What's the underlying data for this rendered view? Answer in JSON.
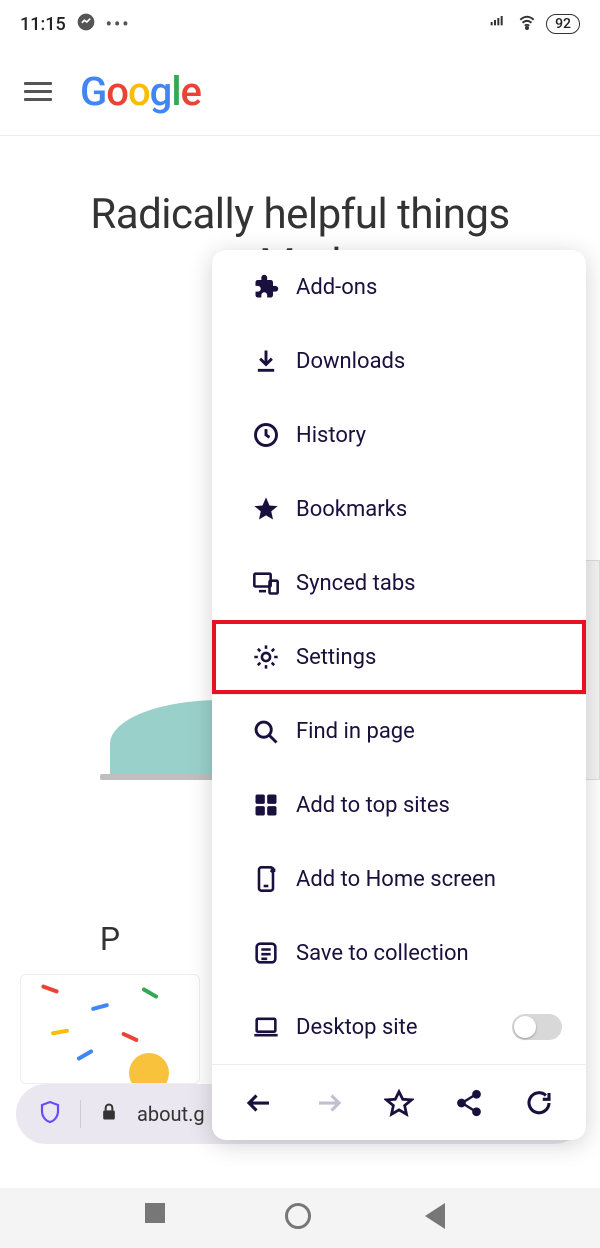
{
  "status": {
    "time": "11:15",
    "battery": "92"
  },
  "header": {
    "logo_text": "Google"
  },
  "hero": {
    "line1": "Radically helpful things",
    "line2_partial": "Mad"
  },
  "products_heading_partial": "P",
  "address_bar": {
    "url_display": "about.g"
  },
  "menu": {
    "items": [
      {
        "id": "addons",
        "label": "Add-ons"
      },
      {
        "id": "downloads",
        "label": "Downloads"
      },
      {
        "id": "history",
        "label": "History"
      },
      {
        "id": "bookmarks",
        "label": "Bookmarks"
      },
      {
        "id": "synced-tabs",
        "label": "Synced tabs"
      },
      {
        "id": "settings",
        "label": "Settings",
        "highlighted": true
      },
      {
        "id": "find",
        "label": "Find in page"
      },
      {
        "id": "top-sites",
        "label": "Add to top sites"
      },
      {
        "id": "home-screen",
        "label": "Add to Home screen"
      },
      {
        "id": "save-collection",
        "label": "Save to collection"
      },
      {
        "id": "desktop-site",
        "label": "Desktop site",
        "has_toggle": true,
        "toggle_on": false
      }
    ]
  }
}
